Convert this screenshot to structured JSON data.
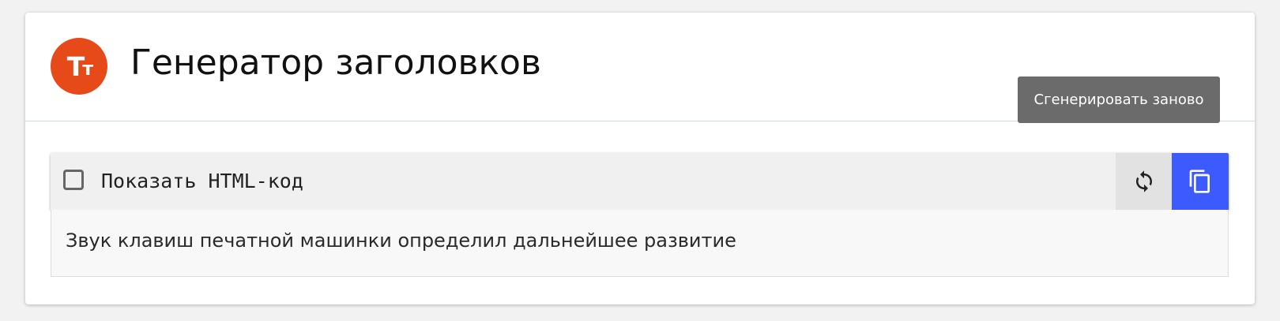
{
  "app": {
    "logo_text": "Тт",
    "logo_color": "#e64a19",
    "title": "Генератор заголовков"
  },
  "tooltip": {
    "text": "Сгенерировать заново"
  },
  "toolbar": {
    "show_html_label": "Показать HTML-код",
    "show_html_checked": false,
    "refresh_icon": "refresh-icon",
    "copy_icon": "copy-icon",
    "copy_button_color": "#3d5afe"
  },
  "output": {
    "text": "Звук клавиш печатной машинки определил дальнейшее развитие"
  }
}
